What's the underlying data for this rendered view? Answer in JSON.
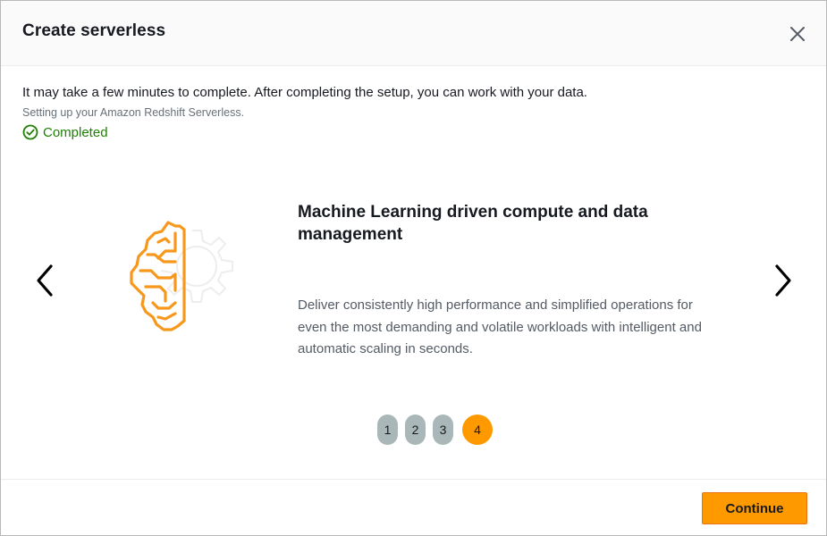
{
  "modal": {
    "title": "Create serverless"
  },
  "intro_text": "It may take a few minutes to complete. After completing the setup, you can work with your data.",
  "sub_text": "Setting up your Amazon Redshift Serverless.",
  "status": {
    "text": "Completed",
    "icon": "check-circle-icon",
    "color": "#1d8102"
  },
  "slide": {
    "title": "Machine Learning driven compute and data management",
    "description": "Deliver consistently high performance and simplified operations for even the most demanding and volatile workloads with intelligent and automatic scaling in seconds.",
    "illustration": "brain-gear-icon"
  },
  "pager": {
    "pages": [
      "1",
      "2",
      "3",
      "4"
    ],
    "active_index": 3
  },
  "footer": {
    "continue_label": "Continue"
  },
  "colors": {
    "accent": "#ff9900",
    "inactive_dot": "#aab7b8",
    "success": "#1d8102"
  }
}
